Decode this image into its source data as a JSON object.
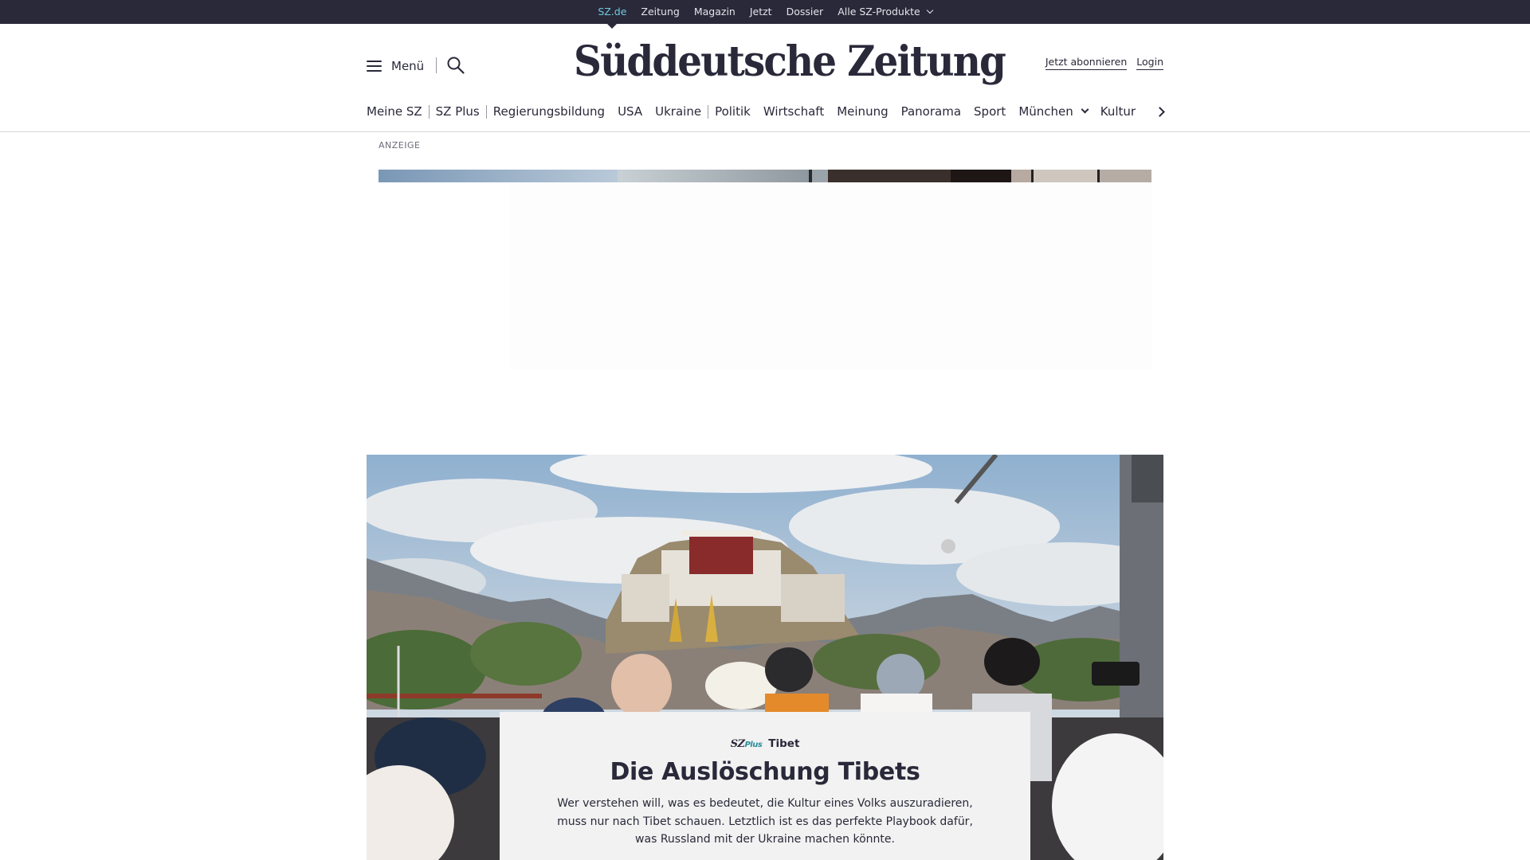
{
  "topbar": {
    "links": [
      {
        "label": "SZ.de",
        "active": true
      },
      {
        "label": "Zeitung"
      },
      {
        "label": "Magazin"
      },
      {
        "label": "Jetzt"
      },
      {
        "label": "Dossier"
      },
      {
        "label": "Alle SZ-Produkte",
        "dropdown": true
      }
    ]
  },
  "header": {
    "menu_label": "Menü",
    "logo": "Süddeutsche Zeitung",
    "subscribe_label": "Jetzt abonnieren",
    "login_label": "Login"
  },
  "nav": {
    "items": [
      "Meine SZ",
      "SZ Plus",
      "Regierungsbildung",
      "USA",
      "Ukraine",
      "Politik",
      "Wirtschaft",
      "Meinung",
      "Panorama",
      "Sport",
      "München",
      "Kultur"
    ]
  },
  "ad": {
    "label": "ANZEIGE"
  },
  "teaser": {
    "badge_sz": "SZ",
    "badge_plus": "Plus",
    "kicker": "Tibet",
    "title": "Die Auslöschung Tibets",
    "text": "Wer verstehen will, was es bedeutet, die Kultur eines Volks auszuradieren, muss nur nach Tibet schauen. Letztlich ist es das perfekte Playbook dafür, was Russland mit der Ukraine machen könnte."
  },
  "colors": {
    "dark": "#29293a",
    "accent": "#71c9dd",
    "plus": "#2a8f9a",
    "teaser_bg": "#f2f2f2"
  }
}
